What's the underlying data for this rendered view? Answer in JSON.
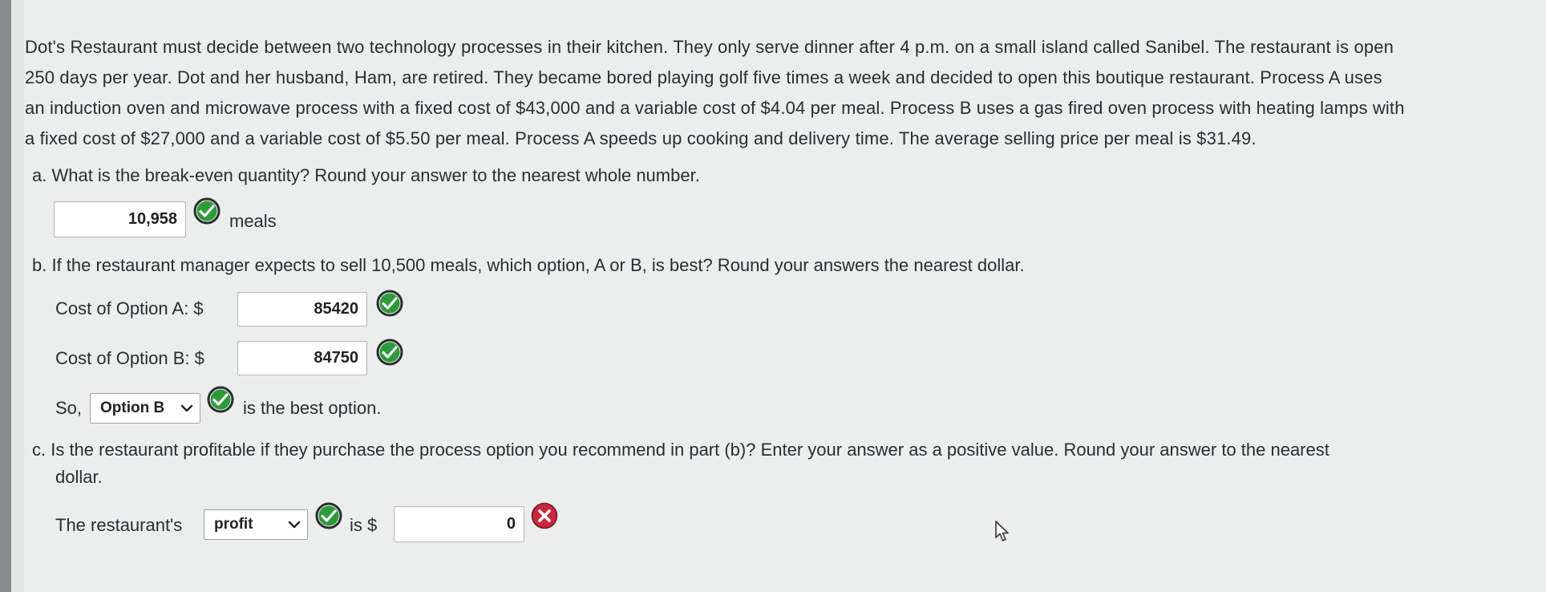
{
  "problem": {
    "lines": [
      "Dot's Restaurant must decide between two technology processes in their kitchen. They only serve dinner after 4 p.m. on a small island called Sanibel. The restaurant is open",
      "250 days per year. Dot and her husband, Ham, are retired. They became bored playing golf five times a week and decided to open this boutique restaurant. Process A uses",
      "an induction oven and microwave process with a fixed cost of $43,000 and a variable cost of $4.04 per meal. Process B uses a gas fired oven process with heating lamps with",
      "a fixed cost of $27,000 and a variable cost of $5.50 per meal. Process A speeds up cooking and delivery time. The average selling price per meal is $31.49."
    ]
  },
  "part_a": {
    "question": "a. What is the break-even quantity? Round your answer to the nearest whole number.",
    "answer": "10,958",
    "unit": "meals",
    "status": "correct"
  },
  "part_b": {
    "question": "b. If the restaurant manager expects to sell 10,500 meals, which option, A or B, is best? Round your answers the nearest dollar.",
    "cost_a_label": "Cost of Option A: $",
    "cost_a_value": "85420",
    "cost_b_label": "Cost of Option B: $",
    "cost_b_value": "84750",
    "so_label": "So,",
    "best_option_selected": "Option B",
    "best_suffix": "is the best option."
  },
  "part_c": {
    "question_line1": "c. Is the restaurant profitable if they purchase the process option you recommend in part (b)? Enter your answer as a positive value. Round your answer to the nearest",
    "question_line2": "dollar.",
    "prefix_label": "The restaurant's",
    "selected": "profit",
    "is_label": "is $",
    "amount_value": "0",
    "amount_status": "incorrect"
  },
  "colors": {
    "correct": "#2e9a3a",
    "incorrect": "#c8283c",
    "background": "#eceeed"
  },
  "icons": [
    "check-circle-icon",
    "x-circle-icon",
    "chevron-down-icon",
    "mouse-cursor-icon"
  ]
}
